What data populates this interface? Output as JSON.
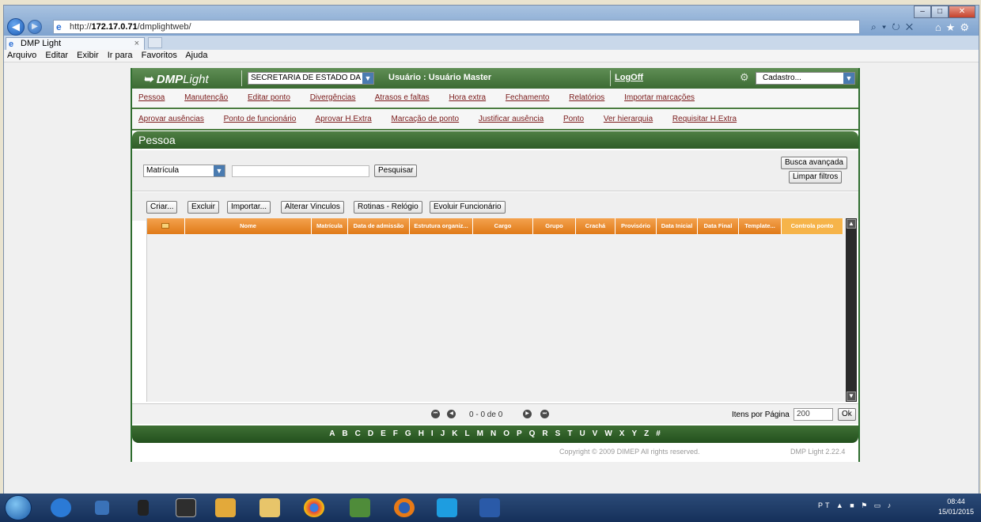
{
  "browser": {
    "url_prefix": "http://",
    "url_host": "172.17.0.71",
    "url_path": "/dmplightweb/",
    "tab_title": "DMP Light",
    "tab_close": "×",
    "menu": [
      "Arquivo",
      "Editar",
      "Exibir",
      "Ir para",
      "Favoritos",
      "Ajuda"
    ]
  },
  "app": {
    "logo_main": "DMP",
    "logo_sub": "Light",
    "org_select": "SECRETARIA DE ESTADO DA SAU",
    "usuario": "Usuário : Usuário Master",
    "logoff": "LogOff",
    "cadastro_select": "Cadastro...",
    "menu1": [
      "Pessoa",
      "Manutenção",
      "Editar ponto",
      "Divergências",
      "Atrasos e faltas",
      "Hora extra",
      "Fechamento",
      "Relatórios",
      "Importar marcações"
    ],
    "menu2": [
      "Aprovar ausências",
      "Ponto de funcionário",
      "Aprovar H.Extra",
      "Marcação de ponto",
      "Justificar ausência",
      "Ponto",
      "Ver hierarquia",
      "Requisitar H.Extra"
    ],
    "section_title": "Pessoa",
    "filter_field": "Matrícula",
    "search_button": "Pesquisar",
    "advanced_search": "Busca avançada",
    "clear_filters": "Limpar filtros",
    "actions": [
      "Criar...",
      "Excluir",
      "Importar...",
      "Alterar Vinculos",
      "Rotinas - Relógio",
      "Evoluir Funcionário"
    ],
    "columns": [
      "Nome",
      "Matrícula",
      "Data de admissão",
      "Estrutura organiz...",
      "Cargo",
      "Grupo",
      "Crachá",
      "Provisório",
      "Data Inicial",
      "Data Final",
      "Template...",
      "Controla ponto"
    ],
    "pager_text": "0 - 0 de 0",
    "items_per_page_label": "Itens por Página",
    "items_per_page_value": "200",
    "ok_button": "Ok",
    "alphabet": [
      "A",
      "B",
      "C",
      "D",
      "E",
      "F",
      "G",
      "H",
      "I",
      "J",
      "K",
      "L",
      "M",
      "N",
      "O",
      "P",
      "Q",
      "R",
      "S",
      "T",
      "U",
      "V",
      "W",
      "X",
      "Y",
      "Z",
      "#"
    ],
    "copyright": "Copyright © 2009 DIMEP All rights reserved.",
    "version": "DMP Light 2.22.4"
  },
  "taskbar": {
    "language": "PT",
    "time": "08:44",
    "date": "15/01/2015"
  },
  "colors": {
    "app_green": "#3c6b33",
    "grid_header_orange": "#e07a18",
    "menu_link": "#7a1a1a"
  }
}
